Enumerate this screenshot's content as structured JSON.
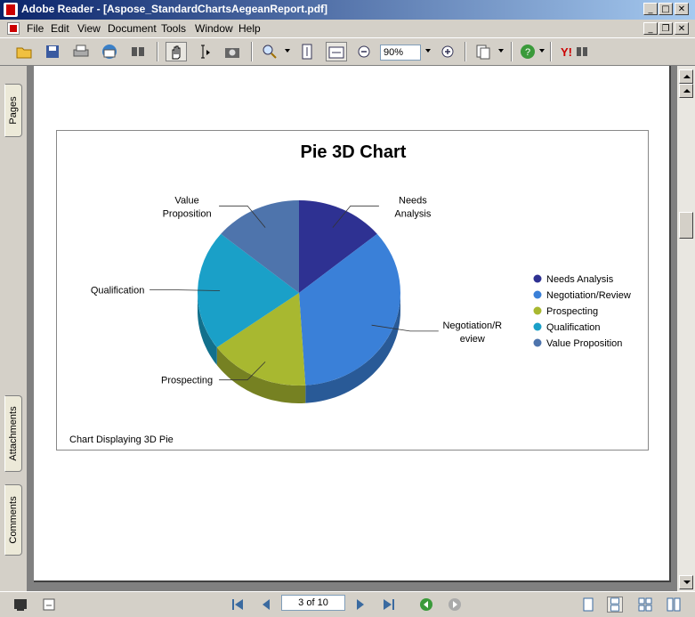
{
  "window": {
    "title": "Adobe Reader - [Aspose_StandardChartsAegeanReport.pdf]",
    "controls": [
      "minimize",
      "maximize",
      "close"
    ]
  },
  "menu": {
    "items": [
      {
        "label": "File"
      },
      {
        "label": "Edit"
      },
      {
        "label": "View"
      },
      {
        "label": "Document"
      },
      {
        "label": "Tools"
      },
      {
        "label": "Window"
      },
      {
        "label": "Help"
      }
    ]
  },
  "toolbar": {
    "zoom_value": "90%",
    "icons": [
      "open-icon",
      "save-icon",
      "print-icon",
      "email-icon",
      "search-icon",
      "hand-icon",
      "select-text-icon",
      "snapshot-icon",
      "zoom-in-icon",
      "fit-page-icon",
      "fit-width-icon",
      "zoom-out-minus-icon",
      "zoom-in-plus-icon",
      "pages-icon",
      "help-icon",
      "yahoo-icon"
    ]
  },
  "side_tabs": {
    "pages": "Pages",
    "attachments": "Attachments",
    "comments": "Comments"
  },
  "status": {
    "page_indicator": "3 of 10"
  },
  "colors": {
    "needs_analysis": "#2e3192",
    "negotiation": "#3a80d8",
    "prospecting": "#a8b830",
    "qualification": "#1aa0c8",
    "value_proposition": "#4e74ac"
  },
  "chart_data": {
    "type": "pie",
    "title": "Pie 3D Chart",
    "footer": "Chart Displaying 3D Pie",
    "legend_position": "right",
    "slices": [
      {
        "name": "Needs Analysis",
        "value": 14,
        "callout": [
          "Needs",
          "Analysis"
        ]
      },
      {
        "name": "Negotiation/Review",
        "value": 35,
        "callout": [
          "Negotiation/R",
          "eview"
        ]
      },
      {
        "name": "Prospecting",
        "value": 16,
        "callout": [
          "Prospecting"
        ]
      },
      {
        "name": "Qualification",
        "value": 21,
        "callout": [
          "Qualification"
        ]
      },
      {
        "name": "Value Proposition",
        "value": 14,
        "callout": [
          "Value",
          "Proposition"
        ]
      }
    ]
  }
}
